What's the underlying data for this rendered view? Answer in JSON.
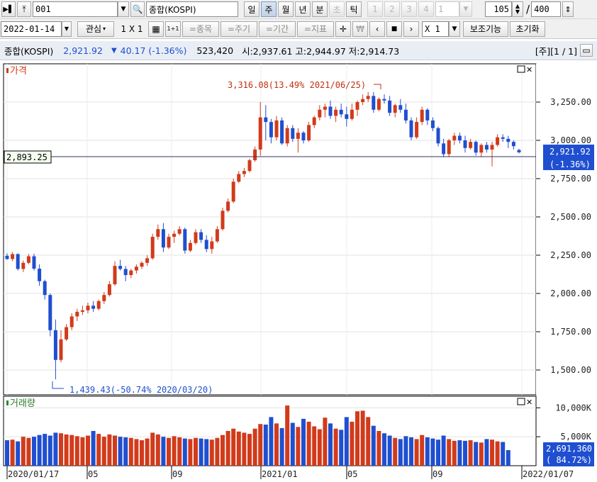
{
  "toolbar1": {
    "code_value": "001",
    "index_name": "종합(KOSPI)",
    "period_tabs": [
      "일",
      "주",
      "월",
      "년",
      "분",
      "초",
      "틱"
    ],
    "active_period": "주",
    "page_numbers": [
      "1",
      "2",
      "3",
      "4"
    ],
    "page_value": "1",
    "count_value": "105",
    "slash": "/",
    "max_value": "400"
  },
  "toolbar2": {
    "date_value": "2022-01-14",
    "watch_label": "관심",
    "grid_label": "1 X 1",
    "onebyone_label": "1+1",
    "item_btn": "=종목",
    "period_btn": "=주기",
    "range_btn": "=기간",
    "indicator_btn": "=지표",
    "multiplier": "X 1",
    "sub_func_label": "보조기능",
    "reset_label": "초기화"
  },
  "infobar": {
    "name": "종합(KOSPI)",
    "price": "2,921.92",
    "down_arrow": "▼",
    "change": "40.17 (-1.36%)",
    "volume": "523,420",
    "ohl": "시:2,937.61 고:2,944.97 저:2,914.73",
    "page_indicator": "[주][1 / 1]"
  },
  "price_panel": {
    "title": "가격",
    "max_annotation": "3,316.08(13.49% 2021/06/25)",
    "min_annotation": "1,439.43(-50.74% 2020/03/20)",
    "hline_label": "2,893.25",
    "current_price": "2,921.92",
    "current_change": "(-1.36%)",
    "y_ticks": [
      "3,250.00",
      "3,000.00",
      "2,750.00",
      "2,500.00",
      "2,250.00",
      "2,000.00",
      "1,750.00",
      "1,500.00"
    ]
  },
  "volume_panel": {
    "title": "거래량",
    "y_ticks": [
      "10,000K",
      "5,000K"
    ],
    "current_volume": "2,691,360",
    "current_pct": "( 84.72%)"
  },
  "x_ticks": [
    "2020/01/17",
    "05",
    "09",
    "2021/01",
    "05",
    "09",
    "2022/01/07"
  ],
  "colors": {
    "up": "#d13b1b",
    "down": "#1f4fd0",
    "panel_bg": "#ffffff",
    "grid": "#d0d0d0",
    "badge": "#1f4fd0"
  },
  "chart_data": {
    "type": "candlestick",
    "period": "weekly",
    "series_name": "종합(KOSPI)",
    "y_range": [
      1380,
      3400
    ],
    "candles": [
      [
        2246,
        2262,
        2220,
        2225
      ],
      [
        2225,
        2270,
        2210,
        2257
      ],
      [
        2257,
        2262,
        2150,
        2160
      ],
      [
        2160,
        2215,
        2140,
        2200
      ],
      [
        2200,
        2258,
        2190,
        2243
      ],
      [
        2243,
        2260,
        2150,
        2162
      ],
      [
        2162,
        2190,
        2050,
        2080
      ],
      [
        2080,
        2090,
        1960,
        1990
      ],
      [
        1990,
        2000,
        1720,
        1760
      ],
      [
        1760,
        1830,
        1439,
        1566
      ],
      [
        1566,
        1760,
        1550,
        1700
      ],
      [
        1700,
        1800,
        1690,
        1780
      ],
      [
        1780,
        1870,
        1760,
        1850
      ],
      [
        1850,
        1900,
        1820,
        1880
      ],
      [
        1880,
        1920,
        1860,
        1890
      ],
      [
        1890,
        1940,
        1870,
        1920
      ],
      [
        1920,
        1950,
        1880,
        1900
      ],
      [
        1900,
        1960,
        1890,
        1950
      ],
      [
        1950,
        2010,
        1930,
        1990
      ],
      [
        1990,
        2080,
        1980,
        2060
      ],
      [
        2060,
        2210,
        2050,
        2180
      ],
      [
        2180,
        2220,
        2150,
        2160
      ],
      [
        2160,
        2180,
        2080,
        2120
      ],
      [
        2120,
        2160,
        2100,
        2150
      ],
      [
        2150,
        2190,
        2130,
        2175
      ],
      [
        2175,
        2210,
        2160,
        2200
      ],
      [
        2200,
        2250,
        2180,
        2230
      ],
      [
        2230,
        2390,
        2220,
        2370
      ],
      [
        2370,
        2450,
        2350,
        2420
      ],
      [
        2420,
        2460,
        2270,
        2300
      ],
      [
        2300,
        2390,
        2290,
        2370
      ],
      [
        2370,
        2410,
        2330,
        2390
      ],
      [
        2390,
        2440,
        2380,
        2420
      ],
      [
        2420,
        2430,
        2260,
        2280
      ],
      [
        2280,
        2350,
        2270,
        2330
      ],
      [
        2330,
        2420,
        2320,
        2400
      ],
      [
        2400,
        2420,
        2330,
        2350
      ],
      [
        2350,
        2380,
        2270,
        2290
      ],
      [
        2290,
        2370,
        2260,
        2340
      ],
      [
        2340,
        2440,
        2330,
        2420
      ],
      [
        2420,
        2560,
        2410,
        2540
      ],
      [
        2540,
        2620,
        2530,
        2600
      ],
      [
        2600,
        2750,
        2590,
        2730
      ],
      [
        2730,
        2800,
        2720,
        2780
      ],
      [
        2780,
        2820,
        2760,
        2800
      ],
      [
        2800,
        2880,
        2790,
        2870
      ],
      [
        2870,
        2960,
        2860,
        2940
      ],
      [
        2940,
        3250,
        2900,
        3150
      ],
      [
        3150,
        3230,
        3000,
        3120
      ],
      [
        3120,
        3140,
        2980,
        3020
      ],
      [
        3020,
        3160,
        3000,
        3130
      ],
      [
        3130,
        3150,
        2970,
        2980
      ],
      [
        2980,
        3100,
        2960,
        3080
      ],
      [
        3080,
        3100,
        2990,
        3010
      ],
      [
        3010,
        3080,
        2920,
        3050
      ],
      [
        3050,
        3060,
        2980,
        3000
      ],
      [
        3000,
        3120,
        2990,
        3100
      ],
      [
        3100,
        3160,
        3080,
        3150
      ],
      [
        3150,
        3230,
        3130,
        3200
      ],
      [
        3200,
        3240,
        3150,
        3220
      ],
      [
        3220,
        3260,
        3140,
        3160
      ],
      [
        3160,
        3220,
        3120,
        3200
      ],
      [
        3200,
        3240,
        3150,
        3170
      ],
      [
        3170,
        3220,
        3090,
        3140
      ],
      [
        3140,
        3240,
        3130,
        3200
      ],
      [
        3200,
        3260,
        3160,
        3250
      ],
      [
        3250,
        3300,
        3230,
        3270
      ],
      [
        3270,
        3316,
        3250,
        3290
      ],
      [
        3290,
        3316,
        3180,
        3200
      ],
      [
        3200,
        3280,
        3190,
        3270
      ],
      [
        3270,
        3300,
        3240,
        3260
      ],
      [
        3260,
        3290,
        3160,
        3180
      ],
      [
        3180,
        3240,
        3150,
        3230
      ],
      [
        3230,
        3270,
        3180,
        3200
      ],
      [
        3200,
        3240,
        3110,
        3130
      ],
      [
        3130,
        3150,
        3000,
        3020
      ],
      [
        3020,
        3150,
        3010,
        3120
      ],
      [
        3120,
        3220,
        3100,
        3200
      ],
      [
        3200,
        3210,
        3100,
        3130
      ],
      [
        3130,
        3150,
        3060,
        3080
      ],
      [
        3080,
        3090,
        2960,
        2980
      ],
      [
        2980,
        3010,
        2890,
        2910
      ],
      [
        2910,
        3010,
        2890,
        3000
      ],
      [
        3000,
        3050,
        2970,
        3030
      ],
      [
        3030,
        3050,
        2980,
        3000
      ],
      [
        3000,
        3030,
        2920,
        2950
      ],
      [
        2950,
        3010,
        2940,
        2990
      ],
      [
        2990,
        3000,
        2900,
        2920
      ],
      [
        2920,
        2980,
        2890,
        2970
      ],
      [
        2970,
        2990,
        2920,
        2940
      ],
      [
        2940,
        2990,
        2830,
        2970
      ],
      [
        2970,
        3040,
        2960,
        3020
      ],
      [
        3020,
        3040,
        2990,
        3010
      ],
      [
        3010,
        3030,
        2950,
        2990
      ],
      [
        2990,
        3000,
        2940,
        2962
      ],
      [
        2937,
        2945,
        2915,
        2922
      ]
    ],
    "volumes_k": [
      4400,
      4500,
      4200,
      5000,
      4800,
      5000,
      5300,
      5500,
      5200,
      5700,
      5600,
      5400,
      5300,
      5100,
      4900,
      5200,
      6000,
      5500,
      5000,
      5400,
      5200,
      5000,
      4900,
      4800,
      4600,
      4400,
      4700,
      5700,
      5400,
      5000,
      4800,
      5100,
      4900,
      4700,
      4600,
      4800,
      4700,
      4600,
      4500,
      4800,
      5300,
      6000,
      6400,
      5900,
      5700,
      5500,
      6400,
      7200,
      7100,
      8400,
      7300,
      6500,
      10400,
      7400,
      6700,
      8100,
      7600,
      6800,
      6300,
      8300,
      7300,
      6400,
      6200,
      8400,
      7600,
      9400,
      9500,
      8400,
      6900,
      6000,
      5600,
      5200,
      4800,
      4600,
      5100,
      4900,
      4600,
      5300,
      4900,
      4700,
      4500,
      5200,
      4600,
      4300,
      4400,
      4300,
      4400,
      4100,
      4000,
      4600,
      4500,
      4200,
      4100,
      2691
    ],
    "volume_y_range": [
      0,
      12000
    ],
    "current_line": 2893.25
  }
}
